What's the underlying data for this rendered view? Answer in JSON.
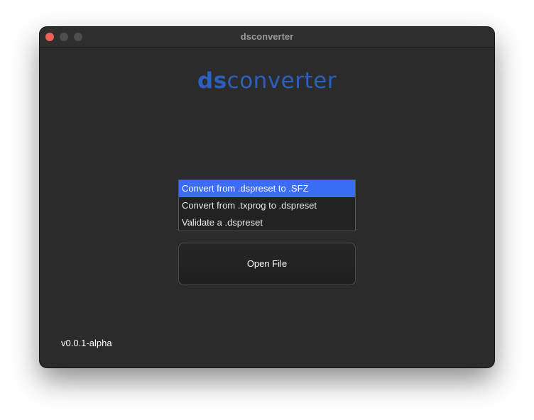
{
  "window": {
    "title": "dsconverter"
  },
  "logo": {
    "bold_part": "ds",
    "light_part": "converter",
    "color": "#2d5fbf"
  },
  "conversion_list": {
    "items": [
      {
        "label": "Convert from .dspreset to .SFZ",
        "selected": true
      },
      {
        "label": "Convert from .txprog to .dspreset",
        "selected": false
      },
      {
        "label": "Validate a .dspreset",
        "selected": false
      }
    ],
    "selection_color": "#3b6cf6"
  },
  "open_button": {
    "label": "Open File"
  },
  "footer": {
    "version": "v0.0.1-alpha"
  },
  "icons": {
    "close": "close-icon",
    "minimize": "minimize-icon",
    "maximize": "maximize-icon"
  }
}
